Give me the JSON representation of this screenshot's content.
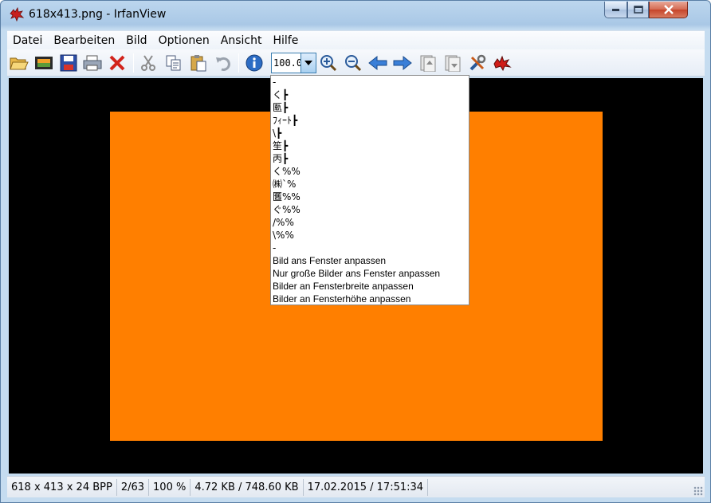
{
  "window": {
    "title": "618x413.png - IrfanView"
  },
  "menu": {
    "items": [
      "Datei",
      "Bearbeiten",
      "Bild",
      "Optionen",
      "Ansicht",
      "Hilfe"
    ]
  },
  "toolbar": {
    "zoom_value": "100.0",
    "icons": [
      "open-icon",
      "thumbnails-icon",
      "save-icon",
      "print-icon",
      "delete-icon",
      "cut-icon",
      "copy-icon",
      "paste-icon",
      "undo-icon",
      "info-icon",
      "zoom-in-icon",
      "zoom-out-icon",
      "previous-icon",
      "next-icon",
      "first-file-icon",
      "last-file-icon",
      "properties-icon",
      "irfanview-logo-icon"
    ]
  },
  "zoom_dropdown": {
    "items": [
      "-",
      "く┣",
      "匭┣",
      "ﾌｨｰﾄ┣",
      "\\┣",
      "笙┣",
      "丙┣",
      "く%%",
      "㈱`%",
      "匶%%",
      "ぐ%%",
      "/%%",
      "\\%%",
      "-",
      "Bild ans Fenster anpassen",
      "Nur große Bilder ans Fenster anpassen",
      "Bilder an Fensterbreite anpassen",
      "Bilder an Fensterhöhe anpassen"
    ]
  },
  "image": {
    "color": "#ff7f00",
    "background": "#000000"
  },
  "status": {
    "dimensions": "618 x 413 x 24 BPP",
    "index": "2/63",
    "zoom": "100 %",
    "size": "4.72 KB / 748.60 KB",
    "datetime": "17.02.2015 / 17:51:34"
  }
}
